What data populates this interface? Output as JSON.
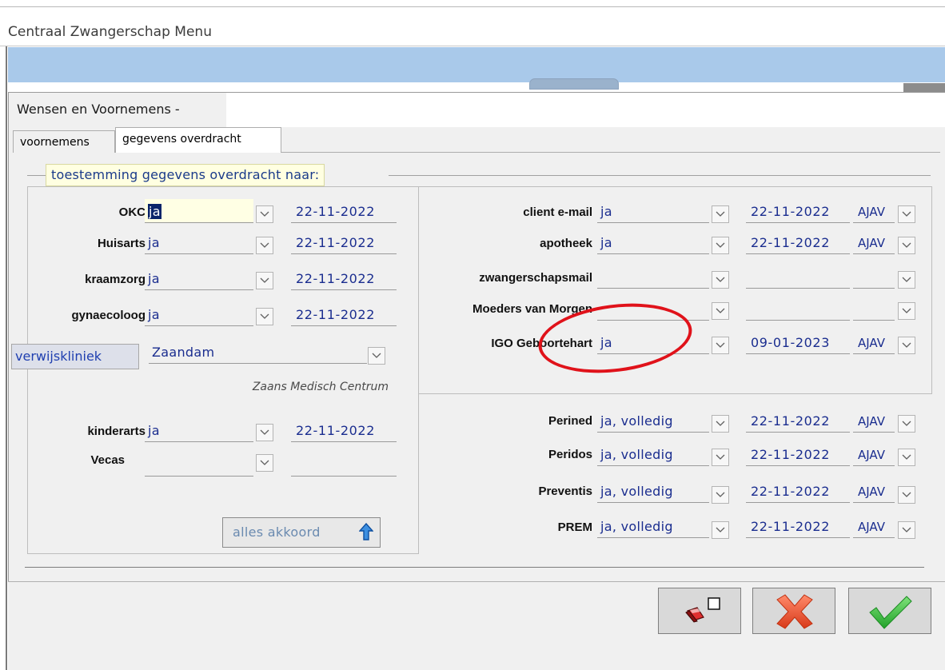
{
  "app": {
    "title": "Centraal Zwangerschap Menu"
  },
  "dialog": {
    "title": "Wensen en Voornemens -"
  },
  "tabs": [
    {
      "label": "voornemens",
      "active": false
    },
    {
      "label": "gegevens overdracht",
      "active": true
    }
  ],
  "group": {
    "legend": "toestemming gegevens overdracht naar:"
  },
  "left": {
    "rows": [
      {
        "label": "OKC",
        "value": "ja",
        "date": "22-11-2022",
        "focused": true
      },
      {
        "label": "Huisarts",
        "value": "ja",
        "date": "22-11-2022"
      },
      {
        "label": "kraamzorg",
        "value": "ja",
        "date": "22-11-2022"
      },
      {
        "label": "gynaecoloog",
        "value": "ja",
        "date": "22-11-2022"
      }
    ],
    "verwijskliniek_label": "verwijskliniek",
    "verwijskliniek_value": "Zaandam",
    "verwijskliniek_sub": "Zaans Medisch Centrum",
    "rows2": [
      {
        "label": "kinderarts",
        "value": "ja",
        "date": "22-11-2022"
      },
      {
        "label": "Vecas",
        "value": "",
        "date": ""
      }
    ],
    "akkoord_label": "alles akkoord"
  },
  "right": {
    "rows": [
      {
        "label": "client e-mail",
        "value": "ja",
        "date": "22-11-2022",
        "user": "AJAV"
      },
      {
        "label": "apotheek",
        "value": "ja",
        "date": "22-11-2022",
        "user": "AJAV"
      },
      {
        "label": "zwangerschapsmail",
        "value": "",
        "date": "",
        "user": ""
      },
      {
        "label": "Moeders van Morgen",
        "value": "",
        "date": "",
        "user": ""
      },
      {
        "label": "IGO Geboortehart",
        "value": "ja",
        "date": "09-01-2023",
        "user": "AJAV"
      }
    ],
    "rows2": [
      {
        "label": "Perined",
        "value": "ja, volledig",
        "date": "22-11-2022",
        "user": "AJAV"
      },
      {
        "label": "Peridos",
        "value": "ja, volledig",
        "date": "22-11-2022",
        "user": "AJAV"
      },
      {
        "label": "Preventis",
        "value": "ja, volledig",
        "date": "22-11-2022",
        "user": "AJAV"
      },
      {
        "label": "PREM",
        "value": "ja, volledig",
        "date": "22-11-2022",
        "user": "AJAV"
      }
    ]
  },
  "buttons": {
    "print": "print-icon",
    "cancel": "red-x-icon",
    "ok": "green-check-icon"
  },
  "colors": {
    "field_text": "#1a2d8f",
    "annotation": "#e0121a",
    "header_band": "#a9c9ea",
    "legend_bg": "#ffffe1"
  }
}
